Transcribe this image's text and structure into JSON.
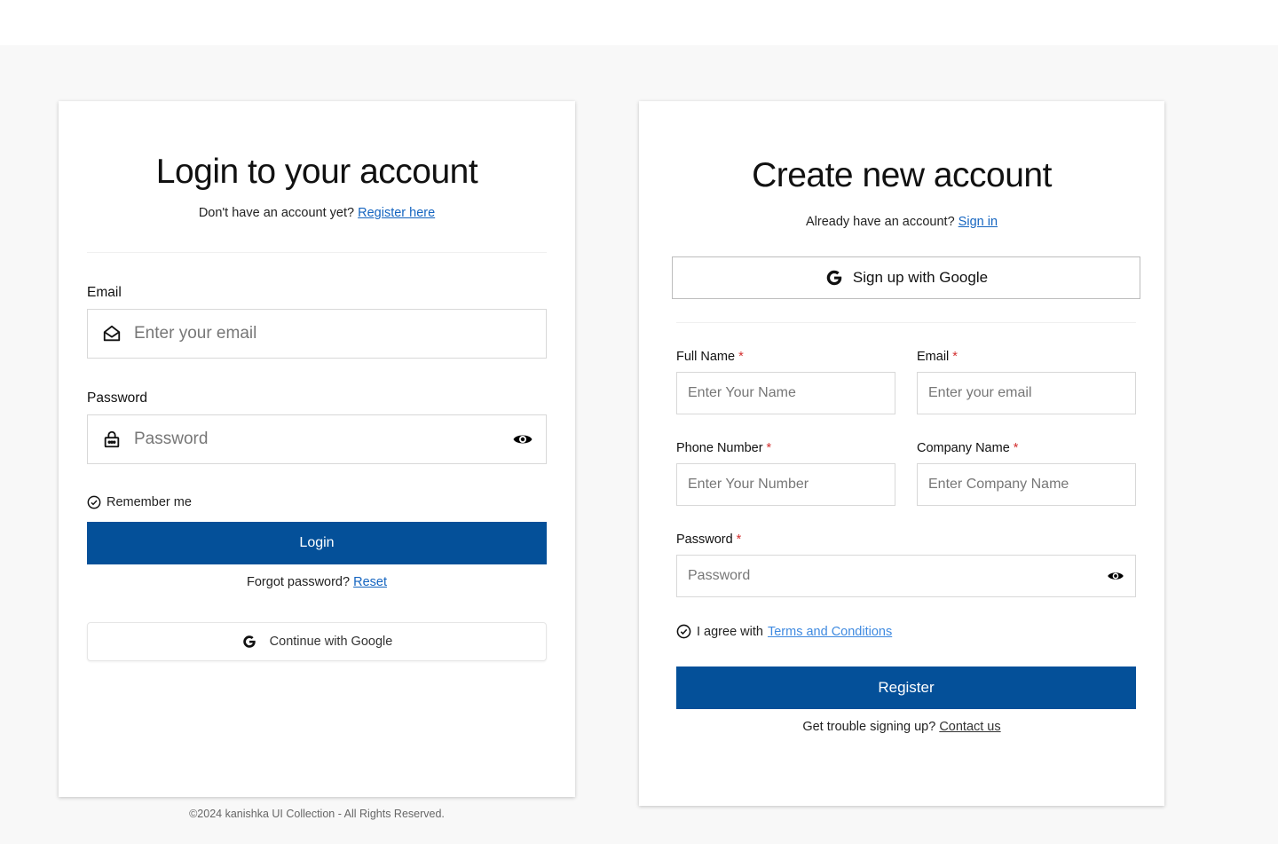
{
  "login": {
    "title": "Login to your account",
    "subtitle_text": "Don't have an account yet?",
    "subtitle_link": "Register here",
    "email_label": "Email",
    "email_placeholder": "Enter your email",
    "password_label": "Password",
    "password_placeholder": "Password",
    "remember_label": "Remember me",
    "login_button": "Login",
    "forgot_text": "Forgot password?",
    "forgot_link": "Reset",
    "google_button": "Continue with Google"
  },
  "register": {
    "title": "Create new account",
    "subtitle_text": "Already have an account?",
    "subtitle_link": "Sign in",
    "google_button": "Sign up with Google",
    "full_name_label": "Full Name",
    "full_name_placeholder": "Enter Your Name",
    "email_label": "Email",
    "email_placeholder": "Enter your email",
    "phone_label": "Phone Number",
    "phone_placeholder": "Enter Your Number",
    "company_label": "Company Name",
    "company_placeholder": "Enter Company Name",
    "password_label": "Password",
    "password_placeholder": "Password",
    "required_marker": "*",
    "agree_text": "I agree with",
    "terms_link": "Terms and Conditions",
    "register_button": "Register",
    "trouble_text": "Get trouble signing up?",
    "contact_link": "Contact us"
  },
  "footer": {
    "copyright": "©2024 kanishka UI Collection - All Rights Reserved."
  },
  "colors": {
    "primary": "#045099",
    "link": "#1565c0",
    "required": "#d32f2f",
    "background": "#f8f8f8"
  },
  "icons": {
    "email": "mail-open-icon",
    "password": "lock-icon",
    "show_password": "eye-icon",
    "check": "check-circle-icon",
    "google": "google-icon"
  }
}
